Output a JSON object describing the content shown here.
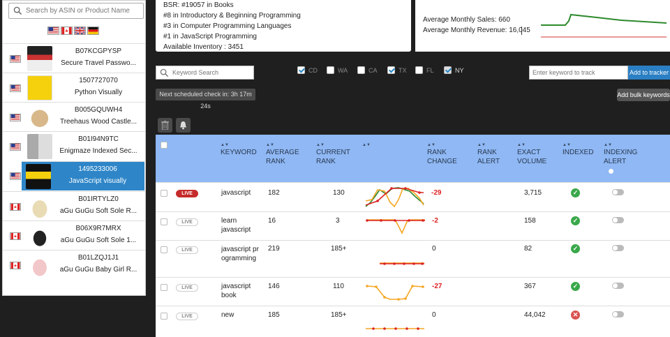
{
  "sidebar": {
    "search_placeholder": "Search by ASIN or Product Name",
    "flags": [
      "us-flag",
      "ca-flag",
      "uk-flag",
      "de-flag"
    ],
    "products": [
      {
        "asin": "B07KCGPYSP",
        "title": "Secure Travel Passwo...",
        "flag": "us"
      },
      {
        "asin": "1507727070",
        "title": "Python Visually",
        "flag": "us"
      },
      {
        "asin": "B005GQUWH4",
        "title": "Treehaus Wood Castle...",
        "flag": "us"
      },
      {
        "asin": "B01I94N9TC",
        "title": "Enigmaze Indexed Sec...",
        "flag": "us"
      },
      {
        "asin": "1495233006",
        "title": "JavaScript visually",
        "flag": "us",
        "selected": true
      },
      {
        "asin": "B01IRTYLZ0",
        "title": "aGu GuGu Soft Sole R...",
        "flag": "ca"
      },
      {
        "asin": "B06X9R7MRX",
        "title": "aGu GuGu Soft Sole 1...",
        "flag": "ca"
      },
      {
        "asin": "B01LZQJ1J1",
        "title": "aGu GuGu Baby Girl R...",
        "flag": "ca"
      }
    ]
  },
  "bsr": {
    "lines": [
      "BSR: #19057 in Books",
      "#8 in Introductory & Beginning Programming",
      "#3 in Computer Programming Languages",
      "#1 in JavaScript Programming",
      "Available Inventory : 3451"
    ]
  },
  "sales": {
    "monthly_sales": "Average Monthly Sales: 660",
    "monthly_revenue": "Average Monthly Revenue: 16,045"
  },
  "controls": {
    "keyword_search_placeholder": "Keyword Search",
    "states": [
      {
        "code": "CD",
        "checked": true
      },
      {
        "code": "WA",
        "checked": false
      },
      {
        "code": "CA",
        "checked": false
      },
      {
        "code": "TX",
        "checked": true
      },
      {
        "code": "FL",
        "checked": false
      },
      {
        "code": "NY",
        "checked": true
      }
    ],
    "track_placeholder": "Enter keyword to track",
    "add_to_tracker": "Add to tracker",
    "add_bulk": "Add bulk keywords",
    "scheduled": "Next scheduled check in: 3h 17m 24s"
  },
  "table": {
    "headers": {
      "keyword": "KEYWORD",
      "avg_rank_1": "AVERAGE",
      "avg_rank_2": "RANK",
      "cur_rank_1": "CURRENT",
      "cur_rank_2": "RANK",
      "rank_change_1": "RANK",
      "rank_change_2": "CHANGE",
      "rank_alert_1": "RANK",
      "rank_alert_2": "ALERT",
      "exact_1": "EXACT",
      "exact_2": "VOLUME",
      "indexed": "INDEXED",
      "idx_alert_1": "INDEXING",
      "idx_alert_2": "ALERT"
    },
    "live_label": "LIVE",
    "rows": [
      {
        "keyword": "javascript",
        "avg": "182",
        "cur": "130",
        "change": "-29",
        "volume": "3,715",
        "indexed": true,
        "live": true
      },
      {
        "keyword": "learn javascript",
        "avg": "16",
        "cur": "3",
        "change": "-2",
        "volume": "158",
        "indexed": true,
        "live": false
      },
      {
        "keyword": "javascript programming",
        "avg": "219",
        "cur": "185+",
        "change": "0",
        "volume": "82",
        "indexed": true,
        "live": false
      },
      {
        "keyword": "javascript book",
        "avg": "146",
        "cur": "110",
        "change": "-27",
        "volume": "367",
        "indexed": true,
        "live": false
      },
      {
        "keyword": "new",
        "avg": "185",
        "cur": "185+",
        "change": "0",
        "volume": "44,042",
        "indexed": false,
        "live": false
      }
    ]
  },
  "colors": {
    "accent": "#2e86c8",
    "header": "#8fb8f4",
    "live": "#c62b2b",
    "ok": "#3aa84a",
    "bad": "#d9534f"
  }
}
